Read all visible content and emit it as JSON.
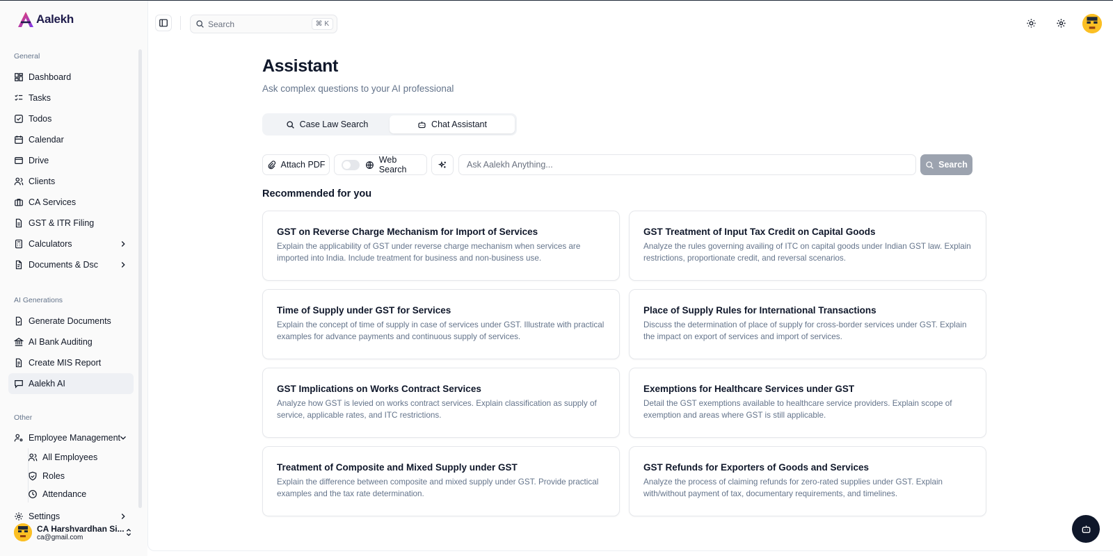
{
  "brand": {
    "name": "Aalekh"
  },
  "sidebar": {
    "sections": [
      {
        "label": "General",
        "items": [
          {
            "label": "Dashboard",
            "icon": "dashboard-icon"
          },
          {
            "label": "Tasks",
            "icon": "tasks-icon"
          },
          {
            "label": "Todos",
            "icon": "todos-icon"
          },
          {
            "label": "Calendar",
            "icon": "calendar-icon"
          },
          {
            "label": "Drive",
            "icon": "drive-icon"
          },
          {
            "label": "Clients",
            "icon": "clients-icon"
          },
          {
            "label": "CA Services",
            "icon": "briefcase-icon"
          },
          {
            "label": "GST & ITR Filing",
            "icon": "file-icon"
          },
          {
            "label": "Calculators",
            "icon": "calculator-icon"
          },
          {
            "label": "Documents & Dsc",
            "icon": "document-icon"
          }
        ]
      },
      {
        "label": "AI Generations",
        "items": [
          {
            "label": "Generate Documents",
            "icon": "file-check-icon"
          },
          {
            "label": "AI Bank Auditing",
            "icon": "bank-icon"
          },
          {
            "label": "Create MIS Report",
            "icon": "file-text-icon"
          },
          {
            "label": "Aalekh AI",
            "icon": "message-icon",
            "active": true
          }
        ]
      },
      {
        "label": "Other",
        "items": [
          {
            "label": "Employee Management",
            "icon": "user-cog-icon"
          },
          {
            "label": "Settings",
            "icon": "gear-icon"
          }
        ],
        "sub_items": [
          {
            "label": "All Employees",
            "icon": "users-icon"
          },
          {
            "label": "Roles",
            "icon": "shield-icon"
          },
          {
            "label": "Attendance",
            "icon": "clock-icon"
          }
        ]
      }
    ],
    "user": {
      "name": "CA Harshvardhan Si...",
      "email": "ca@gmail.com"
    }
  },
  "topbar": {
    "search_placeholder": "Search",
    "shortcut": "⌘ K"
  },
  "page": {
    "title": "Assistant",
    "subtitle": "Ask complex questions to your AI professional",
    "tabs": [
      {
        "label": "Case Law Search",
        "icon": "search-icon"
      },
      {
        "label": "Chat Assistant",
        "icon": "bot-icon",
        "active": true
      }
    ],
    "toolbar": {
      "attach_label": "Attach PDF",
      "web_search_label": "Web Search",
      "web_search_enabled": false,
      "ask_placeholder": "Ask Aalekh Anything...",
      "search_label": "Search"
    },
    "recommended_title": "Recommended for you",
    "cards": [
      {
        "title": "GST on Reverse Charge Mechanism for Import of Services",
        "desc": "Explain the applicability of GST under reverse charge mechanism when services are imported into India. Include treatment for business and non-business use."
      },
      {
        "title": "GST Treatment of Input Tax Credit on Capital Goods",
        "desc": "Analyze the rules governing availing of ITC on capital goods under Indian GST law. Explain restrictions, proportionate credit, and reversal scenarios."
      },
      {
        "title": "Time of Supply under GST for Services",
        "desc": "Explain the concept of time of supply in case of services under GST. Illustrate with practical examples for advance payments and continuous supply of services."
      },
      {
        "title": "Place of Supply Rules for International Transactions",
        "desc": "Discuss the determination of place of supply for cross-border services under GST. Explain the impact on export of services and import of services."
      },
      {
        "title": "GST Implications on Works Contract Services",
        "desc": "Analyze how GST is levied on works contract services. Explain classification as supply of service, applicable rates, and ITC restrictions."
      },
      {
        "title": "Exemptions for Healthcare Services under GST",
        "desc": "Detail the GST exemptions available to healthcare service providers. Explain scope of exemption and areas where GST is still applicable."
      },
      {
        "title": "Treatment of Composite and Mixed Supply under GST",
        "desc": "Explain the difference between composite and mixed supply under GST. Provide practical examples and the tax rate determination."
      },
      {
        "title": "GST Refunds for Exporters of Goods and Services",
        "desc": "Analyze the process of claiming refunds for zero-rated supplies under GST. Explain with/without payment of tax, documentary requirements, and timelines."
      }
    ]
  },
  "colors": {
    "brand_gradient_start": "#e11d48",
    "brand_gradient_end": "#7c3aed",
    "primary_text": "#0f172a",
    "muted_text": "#64748b",
    "disabled_button": "#9ca3af",
    "fab": "#0f172a"
  }
}
